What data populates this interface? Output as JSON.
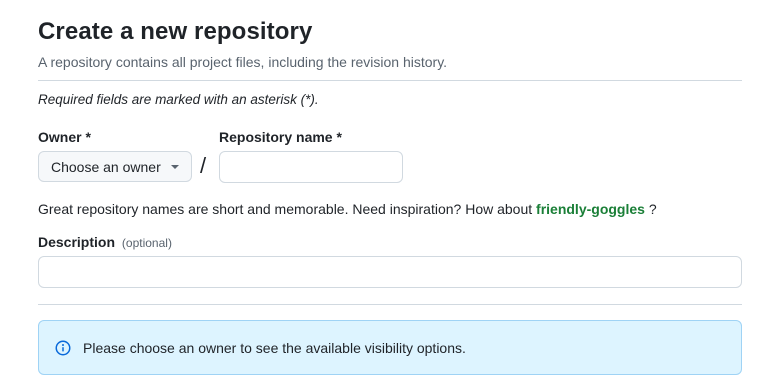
{
  "header": {
    "title": "Create a new repository",
    "subtitle": "A repository contains all project files, including the revision history."
  },
  "form": {
    "required_note": "Required fields are marked with an asterisk (*).",
    "owner": {
      "label": "Owner *",
      "selected": "Choose an owner"
    },
    "repository_name": {
      "label": "Repository name *",
      "value": ""
    },
    "suggestion": {
      "text": "Great repository names are short and memorable. Need inspiration? How about",
      "name": "friendly-goggles",
      "suffix": " ?"
    },
    "description": {
      "label": "Description",
      "optional": "(optional)",
      "value": ""
    }
  },
  "visibility_notice": {
    "icon": "info-icon",
    "text": "Please choose an owner to see the available visibility options."
  },
  "colors": {
    "accent_green": "#1a7f37",
    "info_background": "#ddf4ff",
    "info_border": "#9fd3f5",
    "info_icon": "#0969da"
  }
}
